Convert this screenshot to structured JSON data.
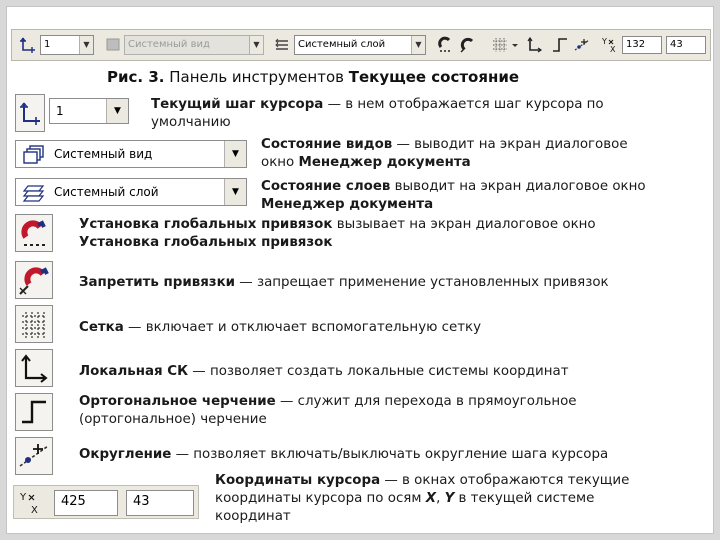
{
  "toolbar": {
    "step_value": "1",
    "view_value": "Системный вид",
    "layer_value": "Системный слой",
    "coord_x": "132",
    "coord_y": "43"
  },
  "caption": {
    "prefix": "Рис. 3.",
    "text": " Панель инструментов ",
    "bold": "Текущее состояние"
  },
  "items": {
    "step": {
      "combo": "1",
      "term": "Текущий шаг курсора",
      "rest": " — в нем отображается шаг курсора по",
      "line2": "умолчанию"
    },
    "view": {
      "combo": "Системный вид",
      "term": "Состояние видов",
      "rest": " — выводит на экран диалоговое",
      "line2a": "окно ",
      "line2b": "Менеджер документа"
    },
    "layer": {
      "combo": "Системный слой",
      "term": "Состояние слоев",
      "rest": " выводит на экран диалоговое окно",
      "line2": "Менеджер документа"
    },
    "snaps": {
      "term": "Установка глобальных привязок",
      "rest": " вызывает на экран диалоговое окно",
      "line2": "Установка глобальных привязок"
    },
    "nosnap": {
      "term": "Запретить привязки",
      "rest": " — запрещает применение установленных привязок"
    },
    "grid": {
      "term": "Сетка",
      "rest": " — включает и отключает вспомогательную сетку"
    },
    "localcs": {
      "term": "Локальная СК",
      "rest": " — позволяет создать локальные системы координат"
    },
    "ortho": {
      "term": "Ортогональное черчение",
      "rest": " — служит для перехода в прямоугольное",
      "line2": "(ортогональное) черчение"
    },
    "round": {
      "term": "Округление",
      "rest": " — позволяет включать/выключать округление шага курсора"
    },
    "coords": {
      "x_value": "425",
      "y_value": "43",
      "term": "Координаты курсора",
      "rest": " — в окнах отображаются текущие",
      "line2a": "координаты курсора по осям ",
      "axis_x": "X",
      "sep": ", ",
      "axis_y": "Y",
      "line2b": " в текущей системе",
      "line3": "координат"
    }
  }
}
